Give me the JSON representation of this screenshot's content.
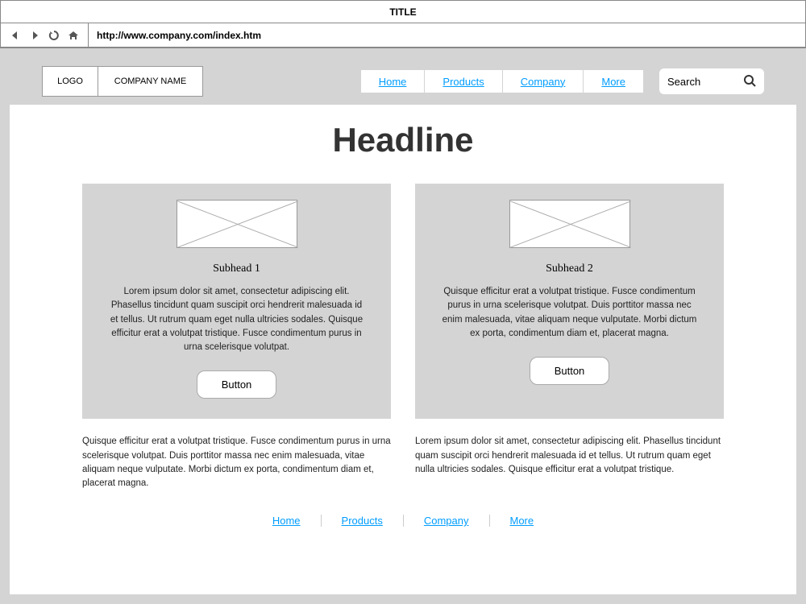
{
  "browser": {
    "title": "TITLE",
    "url": "http://www.company.com/index.htm"
  },
  "header": {
    "logo": "LOGO",
    "company": "COMPANY NAME",
    "nav": [
      "Home",
      "Products",
      "Company",
      "More"
    ],
    "search_placeholder": "Search"
  },
  "headline": "Headline",
  "cards": [
    {
      "subhead": "Subhead 1",
      "text": "Lorem ipsum dolor sit amet, consectetur adipiscing elit. Phasellus tincidunt quam suscipit orci hendrerit malesuada id et tellus. Ut rutrum quam eget nulla ultricies sodales. Quisque efficitur erat a volutpat tristique. Fusce condimentum purus in urna scelerisque volutpat.",
      "button": "Button"
    },
    {
      "subhead": "Subhead 2",
      "text": "Quisque efficitur erat a volutpat tristique. Fusce condimentum purus in urna scelerisque volutpat. Duis porttitor massa nec enim malesuada, vitae aliquam neque vulputate. Morbi dictum ex porta, condimentum diam et, placerat magna.",
      "button": "Button"
    }
  ],
  "lower_texts": [
    "Quisque efficitur erat a volutpat tristique. Fusce condimentum purus in urna scelerisque volutpat. Duis porttitor massa nec enim malesuada, vitae aliquam neque vulputate. Morbi dictum ex porta, condimentum diam et, placerat magna.",
    "Lorem ipsum dolor sit amet, consectetur adipiscing elit. Phasellus tincidunt quam suscipit orci hendrerit malesuada id et tellus. Ut rutrum quam eget nulla ultricies sodales. Quisque efficitur erat a volutpat tristique."
  ],
  "footer_nav": [
    "Home",
    "Products",
    "Company",
    "More"
  ]
}
